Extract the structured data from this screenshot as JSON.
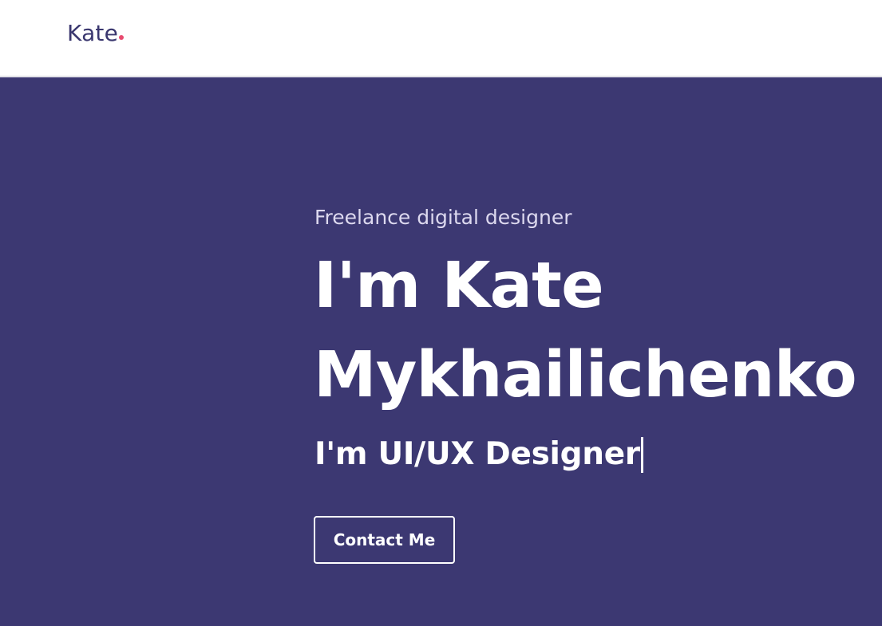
{
  "brand": {
    "name": "Kate",
    "dot_color": "#e84a6f",
    "text_color": "#3a376f"
  },
  "hero": {
    "background_color": "#3c3872",
    "eyebrow": "Freelance digital designer",
    "headline_line_1": "I'm Kate",
    "headline_line_2": "Mykhailichenko",
    "role": "I'm UI/UX Designer",
    "contact_button": "Contact Me"
  },
  "header": {
    "background_color": "#ffffff"
  }
}
